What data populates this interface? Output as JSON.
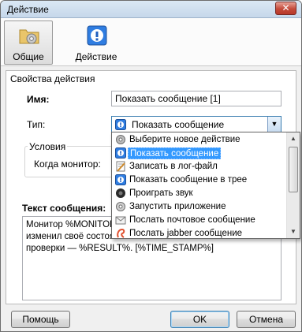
{
  "window": {
    "title": "Действие",
    "close_label": "✕"
  },
  "toolbar": {
    "tabs": [
      {
        "label": "Общие",
        "icon": "folder-gear-icon",
        "active": true
      },
      {
        "label": "Действие",
        "icon": "info-icon",
        "active": false
      }
    ]
  },
  "props": {
    "section_title": "Свойства действия",
    "name_label": "Имя:",
    "name_value": "Показать сообщение [1]",
    "type_label": "Тип:",
    "type_value": "Показать сообщение",
    "conditions_title": "Условия",
    "when_monitor_label": "Когда монитор:"
  },
  "message": {
    "label": "Текст сообщения:",
    "lines": [
      "Монитор %MONITOR",
      "изменил своё состоян",
      "проверки — %RESULT%. [%TIME_STAMP%]"
    ]
  },
  "dropdown": {
    "items": [
      {
        "label": "Выберите новое действие",
        "icon": "gear-icon"
      },
      {
        "label": "Показать сообщение",
        "icon": "info-icon",
        "selected": true
      },
      {
        "label": "Записать в лог-файл",
        "icon": "log-file-icon"
      },
      {
        "label": "Показать сообщение в трее",
        "icon": "info-icon"
      },
      {
        "label": "Проиграть звук",
        "icon": "speaker-icon"
      },
      {
        "label": "Запустить приложение",
        "icon": "gear-icon"
      },
      {
        "label": "Послать почтовое сообщение",
        "icon": "mail-icon"
      },
      {
        "label": "Послать jabber сообщение",
        "icon": "jabber-icon"
      }
    ]
  },
  "buttons": {
    "help": "Помощь",
    "ok": "OK",
    "cancel": "Отмена"
  },
  "colors": {
    "selection": "#3399ff",
    "info_blue": "#1f6fd6",
    "combo_border": "#3c7fb1"
  }
}
